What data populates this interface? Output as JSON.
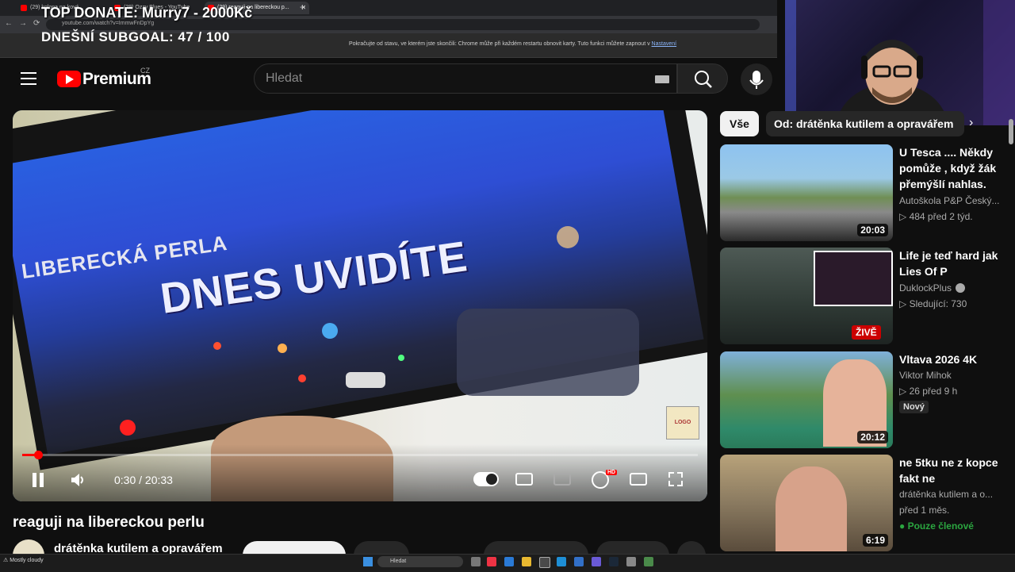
{
  "browser": {
    "tabs": [
      {
        "label": "(29) kolona na ková..."
      },
      {
        "label": "(29) Ozzy Blues - YouTube"
      },
      {
        "label": "(29) reaguji na libereckou p..."
      }
    ],
    "url": "youtube.com/watch?v=ImmwFnDpYg",
    "infobar_text": "Pokračujte od stavu, ve kterém jste skončili: Chrome může při každém restartu obnovit karty. Tuto funkci můžete zapnout v",
    "infobar_link": "Nastavení"
  },
  "overlay": {
    "top_donate": "TOP DONATE: Murry7 - 2000Kč",
    "subgoal": "DNEŠNÍ SUBGOAL:  47 / 100"
  },
  "header": {
    "logo_text": "Premium",
    "country": "CZ",
    "search_placeholder": "Hledat"
  },
  "player": {
    "video_text_top": "LIBERECKÁ PERLA",
    "video_text_main": "DNES UVIDÍTE",
    "time": "0:30 / 20:33",
    "progress": 0.024,
    "hd": "HD"
  },
  "video": {
    "title": "reaguji na libereckou perlu",
    "channel": "drátěnka kutilem a opravářem"
  },
  "sidebar": {
    "chips": [
      "Vše",
      "Od: drátěnka kutilem a opravářem"
    ],
    "items": [
      {
        "title": "U Tesca .... Někdy pomůže , když  žák přemýšlí nahlas.",
        "channel": "Autoškola P&P Český...",
        "meta": "▷ 484  před 2 týd.",
        "duration": "20:03"
      },
      {
        "title": "Life je teď hard jak Lies Of P",
        "channel": "DuklockPlus",
        "meta": "▷ Sledující: 730",
        "badge": "ŽIVĚ"
      },
      {
        "title": "Vltava 2026 4K",
        "channel": "Viktor Mihok",
        "meta": "▷ 26  před 9 h",
        "badge": "Nový",
        "duration": "20:12"
      },
      {
        "title": "ne 5tku ne z kopce fakt ne",
        "channel": "drátěnka kutilem a o...",
        "meta": "před 1 měs.",
        "badge": "Pouze členové",
        "duration": "6:19"
      }
    ]
  },
  "taskbar": {
    "search_placeholder": "Hledat",
    "weather": "Mostly cloudy"
  }
}
